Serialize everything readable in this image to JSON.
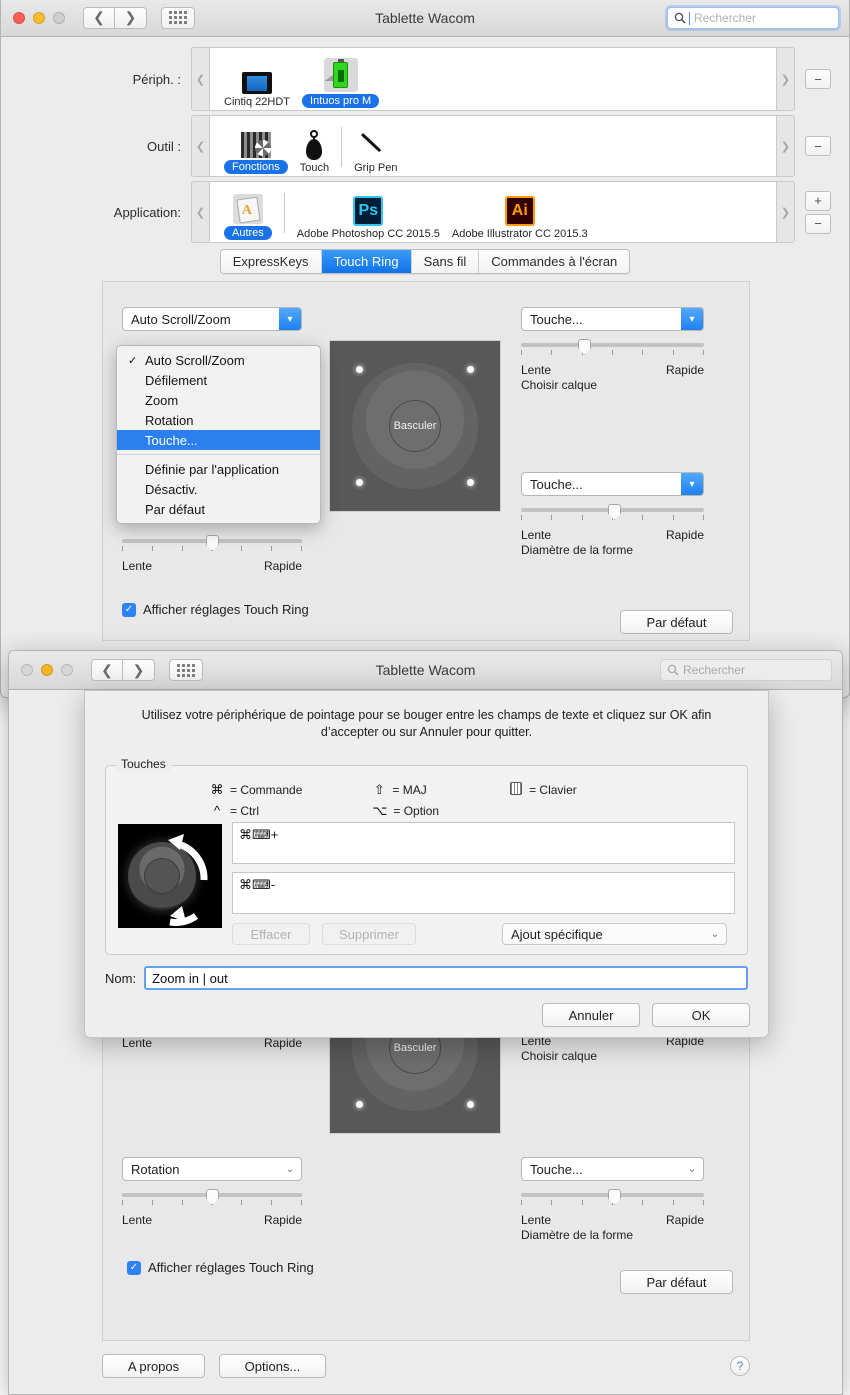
{
  "window_back": {
    "title": "Tablette Wacom",
    "search_placeholder": "Rechercher",
    "rows": [
      {
        "label": "Périph. :",
        "name": "device-row",
        "items": [
          {
            "icon": "cintiq-tablet-icon",
            "caption": "Cintiq 22HDT",
            "selected": false
          },
          {
            "icon": "intuos-battery-icon",
            "caption": "Intuos pro M",
            "selected": true
          }
        ],
        "buttons": [
          "minus"
        ]
      },
      {
        "label": "Outil :",
        "name": "tool-row",
        "items": [
          {
            "icon": "functions-icon",
            "caption": "Fonctions",
            "selected": true
          },
          {
            "icon": "touch-finger-icon",
            "caption": "Touch",
            "selected": false
          },
          {
            "icon": "grip-pen-icon",
            "caption": "Grip Pen",
            "selected": false
          }
        ],
        "buttons": [
          "minus"
        ]
      },
      {
        "label": "Application:",
        "name": "application-row",
        "items": [
          {
            "icon": "others-apps-icon",
            "caption": "Autres",
            "selected": true
          },
          {
            "icon": "photoshop-icon",
            "caption": "Adobe Photoshop CC 2015.5",
            "selected": false
          },
          {
            "icon": "illustrator-icon",
            "caption": "Adobe Illustrator CC 2015.3",
            "selected": false
          }
        ],
        "buttons": [
          "plus",
          "minus"
        ]
      }
    ],
    "tabs": [
      {
        "label": "ExpressKeys",
        "active": false
      },
      {
        "label": "Touch Ring",
        "active": true
      },
      {
        "label": "Sans fil",
        "active": false
      },
      {
        "label": "Commandes à l'écran",
        "active": false
      }
    ],
    "touch_ring": {
      "ring_center_label": "Basculer",
      "top_left_select": "Auto Scroll/Zoom",
      "top_right_select": "Touche...",
      "top_right_caption": "Choisir calque",
      "bottom_right_select": "Touche...",
      "bottom_right_caption": "Diamètre de la forme",
      "slider_min": "Lente",
      "slider_max": "Rapide"
    },
    "dropdown_menu": {
      "items": [
        {
          "label": "Auto Scroll/Zoom",
          "checked": true,
          "highlighted": false
        },
        {
          "label": "Défilement",
          "checked": false,
          "highlighted": false
        },
        {
          "label": "Zoom",
          "checked": false,
          "highlighted": false
        },
        {
          "label": "Rotation",
          "checked": false,
          "highlighted": false
        },
        {
          "label": "Touche...",
          "checked": false,
          "highlighted": true
        },
        {
          "separator": true
        },
        {
          "label": "Définie par l'application",
          "checked": false,
          "highlighted": false
        },
        {
          "label": "Désactiv.",
          "checked": false,
          "highlighted": false
        },
        {
          "label": "Par défaut",
          "checked": false,
          "highlighted": false
        }
      ]
    },
    "show_settings_checkbox": "Afficher réglages Touch Ring",
    "default_button": "Par défaut"
  },
  "window_front": {
    "title": "Tablette Wacom",
    "search_placeholder": "Rechercher",
    "touch_ring": {
      "ring_center_label": "Basculer",
      "left_select": "Rotation",
      "right_select": "Touche...",
      "top_left_min": "Lente",
      "top_left_max": "Rapide",
      "top_right_min": "Lente",
      "top_right_max": "Rapide",
      "top_right_caption": "Choisir calque",
      "bottom_left_min": "Lente",
      "bottom_left_max": "Rapide",
      "bottom_right_min": "Lente",
      "bottom_right_max": "Rapide",
      "bottom_right_caption": "Diamètre de la forme"
    },
    "show_settings_checkbox": "Afficher réglages Touch Ring",
    "default_button": "Par défaut",
    "about_button": "A propos",
    "options_button": "Options...",
    "help_button": "?"
  },
  "sheet": {
    "intro": "Utilisez votre périphérique de pointage pour se bouger entre les champs de texte et cliquez sur OK afin d’accepter ou sur Annuler pour quitter.",
    "group_title": "Touches",
    "legend": [
      {
        "symbol": "⌘",
        "label": "= Commande"
      },
      {
        "symbol": "^",
        "label": "= Ctrl"
      },
      {
        "symbol": "⇧",
        "label": "= MAJ"
      },
      {
        "symbol": "⌥",
        "label": "= Option"
      },
      {
        "symbol": "keyboard-icon",
        "label": "= Clavier"
      }
    ],
    "key_fields": [
      {
        "value": "⌘⌨+"
      },
      {
        "value": "⌘⌨-"
      }
    ],
    "clear_button": "Effacer",
    "delete_button": "Supprimer",
    "add_select": "Ajout spécifique",
    "name_label": "Nom:",
    "name_value": "Zoom in | out",
    "cancel_button": "Annuler",
    "ok_button": "OK",
    "ring_icon": "touch-ring-rotation-icon"
  },
  "colors": {
    "accent_blue": "#1a72e8",
    "selected_menu": "#2b7fee",
    "window_bg": "#ececec",
    "panel_bg": "#e8e8e8",
    "ring_bg": "#585858"
  }
}
